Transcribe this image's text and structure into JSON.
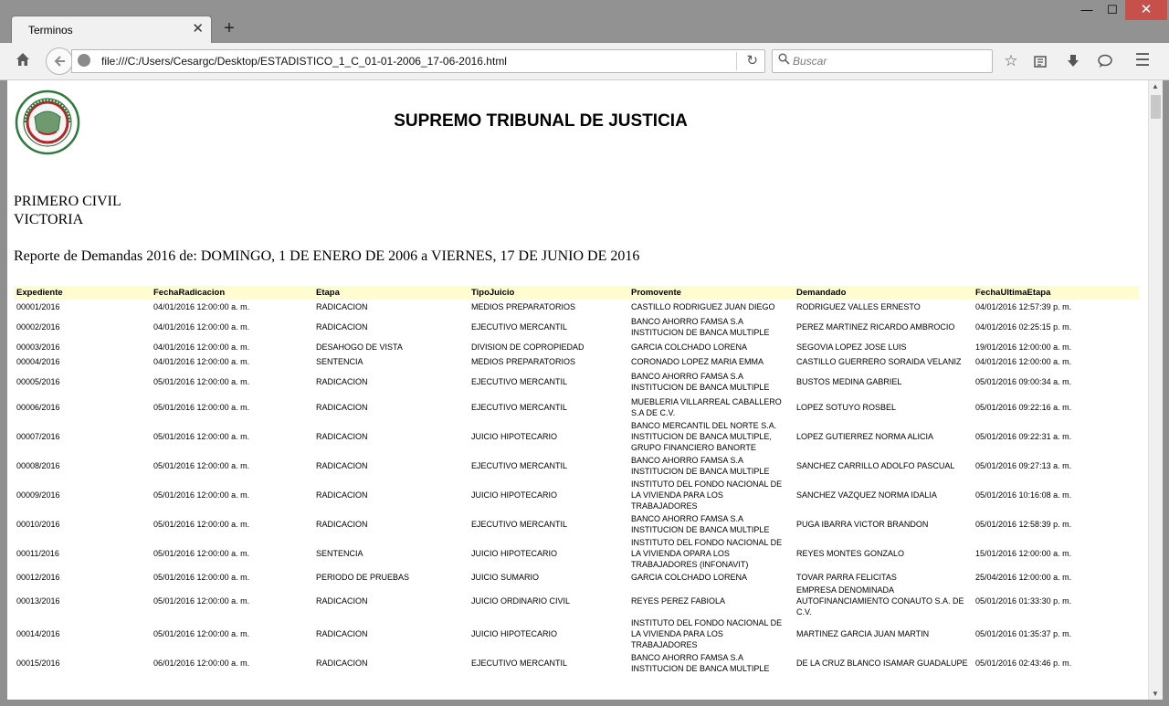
{
  "browser": {
    "tab_title": "Terminos",
    "tab_close": "✕",
    "new_tab": "+",
    "url": "file:///C:/Users/Cesargc/Desktop/ESTADISTICO_1_C_01-01-2006_17-06-2016.html",
    "search_placeholder": "Buscar",
    "window_controls": {
      "minimize": "—",
      "maximize": "☐",
      "close": "✕"
    },
    "icons": [
      "home-icon",
      "back-arrow-icon",
      "globe-icon",
      "reload-icon",
      "search-icon",
      "bookmark-star-icon",
      "reading-list-icon",
      "download-icon",
      "chat-icon",
      "hamburger-menu-icon"
    ]
  },
  "page": {
    "title": "SUPREMO TRIBUNAL DE JUSTICIA",
    "court_name": "PRIMERO CIVIL",
    "court_city": "VICTORIA",
    "report_range": "Reporte de Demandas 2016 de: DOMINGO, 1 DE ENERO DE 2006 a VIERNES, 17 DE JUNIO DE 2016",
    "logo_text": "PODER JUDICIAL TAMAULIPAS",
    "colors": {
      "header_bg": "#fffdd0",
      "logo_red": "#b3262b",
      "logo_green": "#2d7a3a"
    }
  },
  "table": {
    "headers": [
      "Expediente",
      "FechaRadicacion",
      "Etapa",
      "TipoJuicio",
      "Promovente",
      "Demandado",
      "FechaUltimaEtapa"
    ],
    "rows": [
      [
        "00001/2016",
        "04/01/2016 12:00:00 a. m.",
        "RADICACION",
        "MEDIOS PREPARATORIOS",
        "CASTILLO RODRIGUEZ JUAN DIEGO",
        "RODRIGUEZ VALLES ERNESTO",
        "04/01/2016 12:57:39 p. m."
      ],
      [
        "00002/2016",
        "04/01/2016 12:00:00 a. m.",
        "RADICACION",
        "EJECUTIVO MERCANTIL",
        "BANCO AHORRO FAMSA S.A INSTITUCION DE BANCA MULTIPLE",
        "PEREZ MARTINEZ RICARDO AMBROCIO",
        "04/01/2016 02:25:15 p. m."
      ],
      [
        "00003/2016",
        "04/01/2016 12:00:00 a. m.",
        "DESAHOGO DE VISTA",
        "DIVISION DE COPROPIEDAD",
        "GARCIA COLCHADO LORENA",
        "SEGOVIA LOPEZ JOSE LUIS",
        "19/01/2016 12:00:00 a. m."
      ],
      [
        "00004/2016",
        "04/01/2016 12:00:00 a. m.",
        "SENTENCIA",
        "MEDIOS PREPARATORIOS",
        "CORONADO LOPEZ MARIA EMMA",
        "CASTILLO GUERRERO SORAIDA VELANIZ",
        "04/01/2016 12:00:00 a. m."
      ],
      [
        "00005/2016",
        "05/01/2016 12:00:00 a. m.",
        "RADICACION",
        "EJECUTIVO MERCANTIL",
        "BANCO AHORRO FAMSA S.A INSTITUCION DE BANCA MULTIPLE",
        "BUSTOS MEDINA GABRIEL",
        "05/01/2016 09:00:34 a. m."
      ],
      [
        "00006/2016",
        "05/01/2016 12:00:00 a. m.",
        "RADICACION",
        "EJECUTIVO MERCANTIL",
        "MUEBLERIA VILLARREAL CABALLERO S.A DE C.V.",
        "LOPEZ SOTUYO ROSBEL",
        "05/01/2016 09:22:16 a. m."
      ],
      [
        "00007/2016",
        "05/01/2016 12:00:00 a. m.",
        "RADICACION",
        "JUICIO HIPOTECARIO",
        "BANCO MERCANTIL DEL NORTE S.A. INSTITUCION DE BANCA MULTIPLE, GRUPO FINANCIERO BANORTE",
        "LOPEZ GUTIERREZ NORMA ALICIA",
        "05/01/2016 09:22:31 a. m."
      ],
      [
        "00008/2016",
        "05/01/2016 12:00:00 a. m.",
        "RADICACION",
        "EJECUTIVO MERCANTIL",
        "BANCO AHORRO FAMSA S.A INSTITUCION DE BANCA MULTIPLE",
        "SANCHEZ CARRILLO ADOLFO PASCUAL",
        "05/01/2016 09:27:13 a. m."
      ],
      [
        "00009/2016",
        "05/01/2016 12:00:00 a. m.",
        "RADICACION",
        "JUICIO HIPOTECARIO",
        "INSTITUTO DEL FONDO NACIONAL DE LA VIVIENDA PARA LOS TRABAJADORES",
        "SANCHEZ VAZQUEZ NORMA IDALIA",
        "05/01/2016 10:16:08 a. m."
      ],
      [
        "00010/2016",
        "05/01/2016 12:00:00 a. m.",
        "RADICACION",
        "EJECUTIVO MERCANTIL",
        "BANCO AHORRO FAMSA S.A INSTITUCION DE BANCA MULTIPLE",
        "PUGA IBARRA VICTOR BRANDON",
        "05/01/2016 12:58:39 p. m."
      ],
      [
        "00011/2016",
        "05/01/2016 12:00:00 a. m.",
        "SENTENCIA",
        "JUICIO HIPOTECARIO",
        "INSTITUTO DEL FONDO NACIONAL DE LA VIVIENDA OPARA LOS TRABAJADORES (INFONAVIT)",
        "REYES MONTES GONZALO",
        "15/01/2016 12:00:00 a. m."
      ],
      [
        "00012/2016",
        "05/01/2016 12:00:00 a. m.",
        "PERIODO DE PRUEBAS",
        "JUICIO SUMARIO",
        "GARCIA COLCHADO LORENA",
        "TOVAR PARRA FELICITAS",
        "25/04/2016 12:00:00 a. m."
      ],
      [
        "00013/2016",
        "05/01/2016 12:00:00 a. m.",
        "RADICACION",
        "JUICIO ORDINARIO CIVIL",
        "REYES PEREZ FABIOLA",
        "EMPRESA DENOMINADA AUTOFINANCIAMIENTO CONAUTO S.A. DE C.V.",
        "05/01/2016 01:33:30 p. m."
      ],
      [
        "00014/2016",
        "05/01/2016 12:00:00 a. m.",
        "RADICACION",
        "JUICIO HIPOTECARIO",
        "INSTITUTO DEL FONDO NACIONAL DE LA VIVIENDA PARA LOS TRABAJADORES",
        "MARTINEZ GARCIA JUAN MARTIN",
        "05/01/2016 01:35:37 p. m."
      ],
      [
        "00015/2016",
        "06/01/2016 12:00:00 a. m.",
        "RADICACION",
        "EJECUTIVO MERCANTIL",
        "BANCO AHORRO FAMSA S.A INSTITUCION DE BANCA MULTIPLE",
        "DE LA CRUZ BLANCO ISAMAR GUADALUPE",
        "05/01/2016 02:43:46 p. m."
      ]
    ],
    "row_line_counts": [
      1,
      2,
      1,
      1,
      2,
      2,
      3,
      2,
      3,
      2,
      3,
      1,
      3,
      3,
      2
    ]
  }
}
